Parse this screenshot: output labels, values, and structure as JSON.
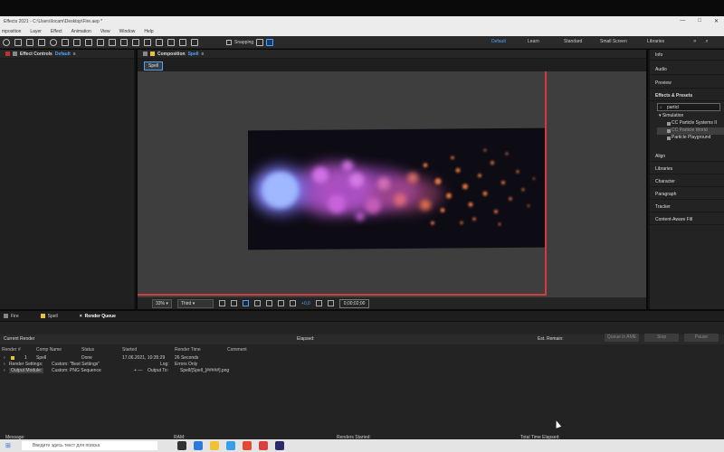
{
  "window": {
    "title": "Effects 2021 - C:\\Users\\locam\\Desktop\\Fire.aep *",
    "controls": [
      "—",
      "□",
      "✕"
    ]
  },
  "menu": [
    "mposition",
    "Layer",
    "Effect",
    "Animation",
    "View",
    "Window",
    "Help"
  ],
  "toolbar": {
    "snapping_label": "Snapping",
    "workspaces": [
      "Default",
      "Learn",
      "Standard",
      "Small Screen",
      "Libraries"
    ],
    "active_workspace": "Default"
  },
  "effect_controls": {
    "title": "Effect Controls",
    "layer": "Default"
  },
  "composition": {
    "title": "Composition",
    "name": "Spell",
    "tab": "Spell",
    "zoom": "33%",
    "resolution": "Third",
    "exposure": "+0,0",
    "timecode": "0;00;02;00"
  },
  "right_panel": {
    "items": [
      "Info",
      "Audio",
      "Preview",
      "Effects & Presets"
    ],
    "search_value": "particl",
    "category": "Simulation",
    "results": [
      "CC Particle Systems II",
      "CC Particle World",
      "Particle Playground"
    ],
    "selected_result": "CC Particle World",
    "lower_items": [
      "Align",
      "Libraries",
      "Character",
      "Paragraph",
      "Tracker",
      "Content-Aware Fill"
    ]
  },
  "bottom_tabs": [
    "Fire",
    "Spell",
    "Render Queue"
  ],
  "render_queue": {
    "current_render_label": "Current Render",
    "elapsed_label": "Elapsed:",
    "est_remain_label": "Est. Remain:",
    "buttons": [
      "Queue in AME",
      "Stop",
      "Pause"
    ],
    "headers": [
      "Render",
      "#",
      "Comp Name",
      "Status",
      "Started",
      "Render Time",
      "Comment"
    ],
    "row": {
      "index": "1",
      "comp": "Spell",
      "status": "Done",
      "started": "17.06.2021, 10:35:29",
      "render_time": "26 Seconds"
    },
    "render_settings_label": "Render Settings:",
    "render_settings_value": "Custom: \"Best Settings\"",
    "log_label": "Log:",
    "log_value": "Errors Only",
    "output_module_label": "Output Module:",
    "output_module_value": "Custom: PNG Sequence",
    "output_to_label": "Output To:",
    "output_to_value": "Spell/[Spell_[#####].png",
    "footer": {
      "message_label": "Message:",
      "ram_label": "RAM:",
      "renders_started_label": "Renders Started:",
      "total_time_label": "Total Time Elapsed:"
    }
  },
  "taskbar": {
    "search_placeholder": "Введите здесь текст для поиска"
  },
  "colors": {
    "accent": "#4ea3ff",
    "guide": "#d23c3c",
    "panel": "#232323",
    "viewer": "#3e3e3e"
  }
}
